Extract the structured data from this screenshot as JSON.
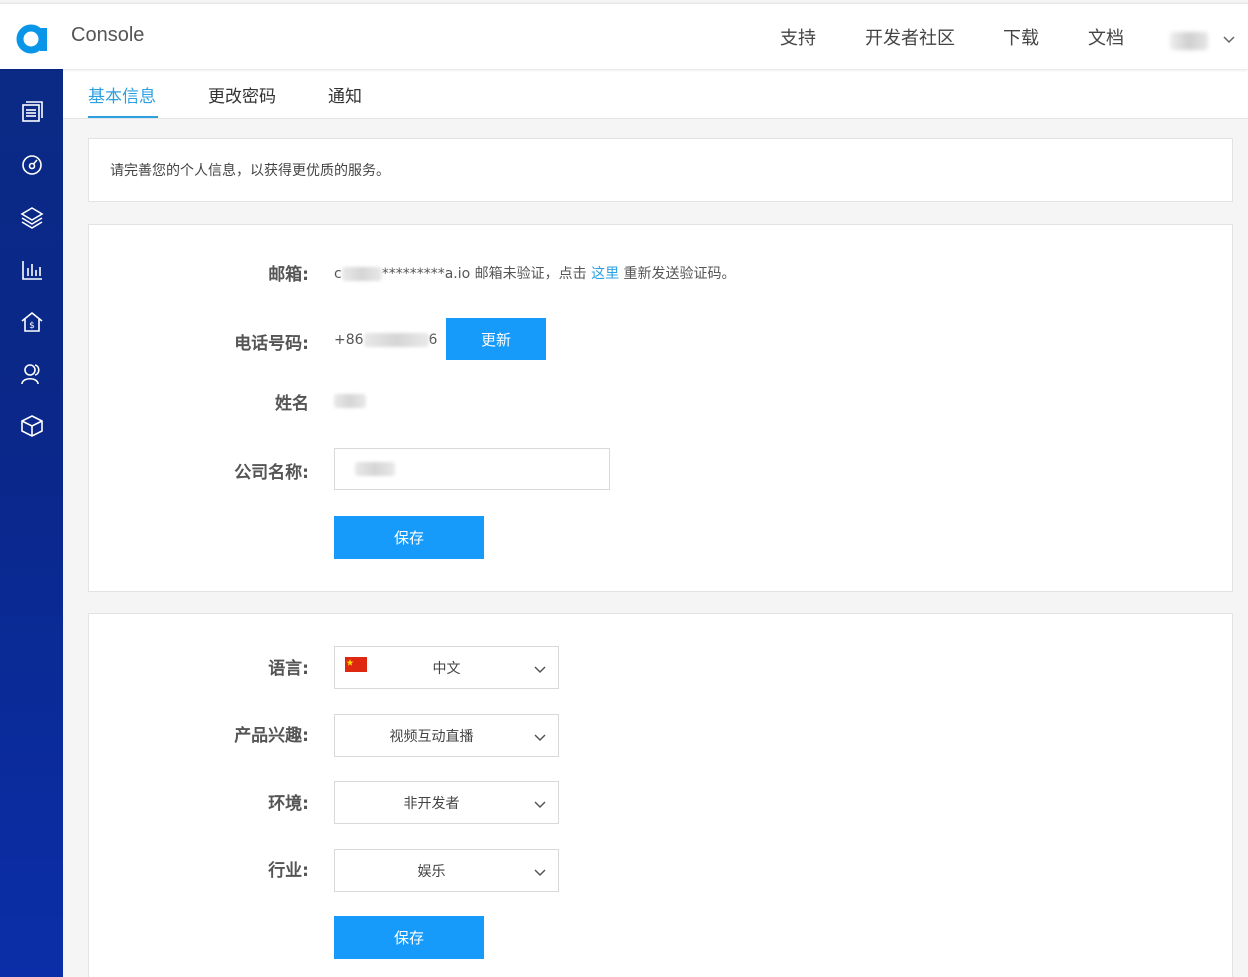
{
  "header": {
    "brand": "Console",
    "nav": [
      "支持",
      "开发者社区",
      "下载",
      "文档"
    ]
  },
  "tabs": [
    {
      "label": "基本信息",
      "active": true
    },
    {
      "label": "更改密码",
      "active": false
    },
    {
      "label": "通知",
      "active": false
    }
  ],
  "notice": "请完善您的个人信息，以获得更优质的服务。",
  "profile": {
    "email_label": "邮箱:",
    "email_prefix": "c",
    "email_suffix": "*********a.io",
    "email_status": "邮箱未验证，点击",
    "email_link": "这里",
    "email_after": "重新发送验证码。",
    "phone_label": "电话号码:",
    "phone_prefix": "+86",
    "phone_suffix": "6",
    "update_button": "更新",
    "name_label": "姓名",
    "company_label": "公司名称:",
    "save_button": "保存"
  },
  "preferences": {
    "language_label": "语言:",
    "language_value": "中文",
    "interest_label": "产品兴趣:",
    "interest_value": "视频互动直播",
    "env_label": "环境:",
    "env_value": "非开发者",
    "industry_label": "行业:",
    "industry_value": "娱乐",
    "save_button": "保存"
  },
  "colors": {
    "accent": "#2ea0e0",
    "primary_button": "#169bfa",
    "sidebar": "#0a2a86"
  },
  "icons": {
    "sidebar": [
      "list-icon",
      "dashboard-icon",
      "layers-icon",
      "bar-chart-icon",
      "billing-icon",
      "users-icon",
      "box-icon"
    ]
  }
}
